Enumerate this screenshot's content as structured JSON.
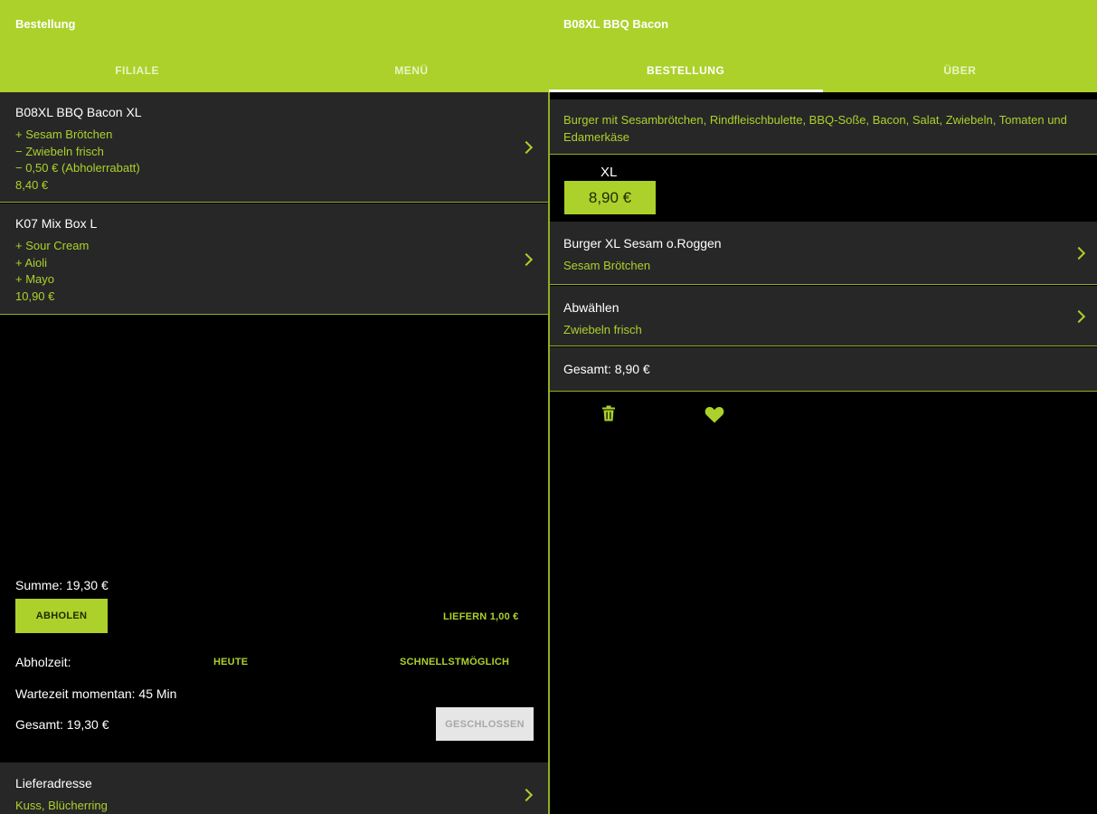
{
  "header": {
    "left_title": "Bestellung",
    "right_title": "B08XL BBQ Bacon",
    "tabs": [
      {
        "label": "FILIALE",
        "active": false
      },
      {
        "label": "MENÜ",
        "active": false
      },
      {
        "label": "BESTELLUNG",
        "active": true
      },
      {
        "label": "ÜBER",
        "active": false
      }
    ]
  },
  "colors": {
    "accent": "#acd12b",
    "panel": "#272727",
    "background": "#000000"
  },
  "cart": {
    "items": [
      {
        "name": "B08XL BBQ Bacon XL",
        "options": [
          "+ Sesam Brötchen",
          "− Zwiebeln frisch",
          "− 0,50 € (Abholerrabatt)",
          "8,40 €"
        ]
      },
      {
        "name": "K07 Mix Box L",
        "options": [
          "+ Sour Cream",
          "+ Aioli",
          "+ Mayo",
          "10,90 €"
        ]
      }
    ],
    "summe": "Summe: 19,30 €",
    "abholen_label": "ABHOLEN",
    "liefern_label": "LIEFERN 1,00 €",
    "abholzeit_label": "Abholzeit:",
    "heute_label": "HEUTE",
    "schnell_label": "SCHNELLSTMÖGLICH",
    "wartezeit": "Wartezeit momentan: 45 Min",
    "gesamt": "Gesamt: 19,30 €",
    "closed_label": "GESCHLOSSEN",
    "address_label": "Lieferadresse",
    "address_value": "Kuss, Blücherring"
  },
  "product": {
    "description": "Burger mit Sesambrötchen, Rindfleischbulette, BBQ-Soße, Bacon, Salat, Zwiebeln, Tomaten und Edamerkäse",
    "size": "XL",
    "price": "8,90 €",
    "options": [
      {
        "title": "Burger XL Sesam o.Roggen",
        "value": "Sesam Brötchen"
      },
      {
        "title": "Abwählen",
        "value": "Zwiebeln frisch"
      }
    ],
    "total": "Gesamt: 8,90 €"
  }
}
